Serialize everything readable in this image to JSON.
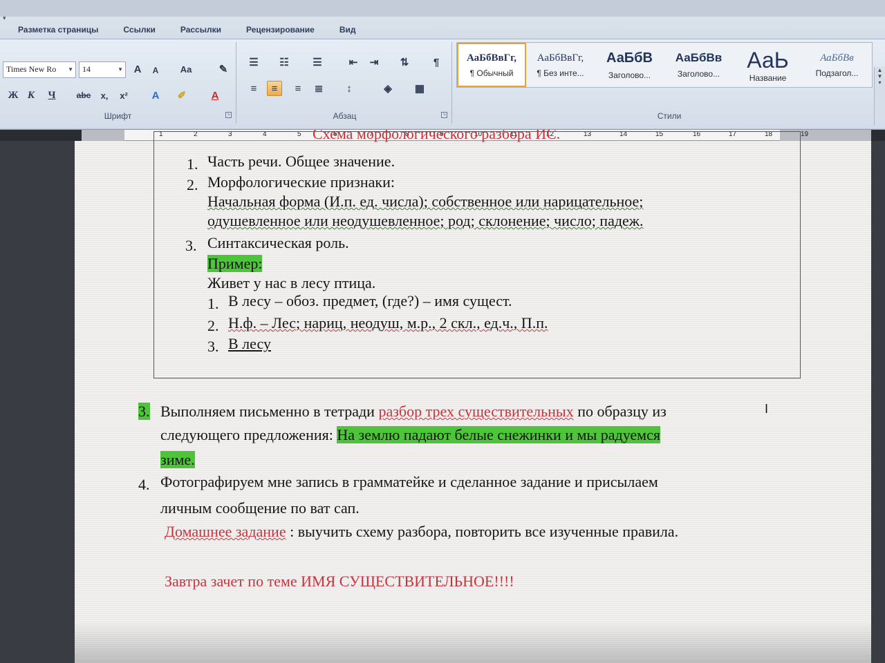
{
  "ribbon": {
    "tabs": [
      "Разметка страницы",
      "Ссылки",
      "Рассылки",
      "Рецензирование",
      "Вид"
    ],
    "font": {
      "name": "Times New Ro",
      "size": "14",
      "group_label": "Шрифт"
    },
    "paragraph": {
      "group_label": "Абзац"
    },
    "styles": {
      "group_label": "Стили",
      "items": [
        {
          "sample": "АаБбВвГг,",
          "name": "¶ Обычный"
        },
        {
          "sample": "АаБбВвГг,",
          "name": "¶ Без инте..."
        },
        {
          "sample": "АаБбВ",
          "name": "Заголово..."
        },
        {
          "sample": "АаБбВв",
          "name": "Заголово..."
        },
        {
          "sample": "АаЬ",
          "name": "Название"
        },
        {
          "sample": "АаБбВв",
          "name": "Подзагол..."
        }
      ]
    }
  },
  "ruler": {
    "numbers": [
      "1",
      "2",
      "3",
      "4",
      "5",
      "6",
      "7",
      "8",
      "9",
      "10",
      "11",
      "12",
      "13",
      "14",
      "15",
      "16",
      "17",
      "18",
      "19"
    ]
  },
  "document": {
    "cut_title": "Схема морфологического разбора ИС.",
    "list_items": [
      {
        "num": "1.",
        "text": "Часть речи. Общее значение."
      },
      {
        "num": "2.",
        "text": "Морфологические признаки:"
      },
      {
        "num": "3.",
        "text": "Синтаксическая роль."
      }
    ],
    "morph_line1": "Начальная форма (И.п. ед. числа); собственное или нарицательное;",
    "morph_line2": "одушевленное или неодушевленное; род; склонение; число; падеж.",
    "example_label": "Пример:",
    "example_sentence": "Живет у нас в лесу птица.",
    "sub_items": [
      {
        "num": "1.",
        "text": "В лесу – обоз. предмет, (где?) – имя сущест."
      },
      {
        "num": "2.",
        "text": "Н.ф. – Лес; нариц, неодуш, м.р., 2 скл., ед.ч., П.п."
      },
      {
        "num": "3.",
        "text": "В лесу"
      }
    ],
    "task3": {
      "num": "3.",
      "before": "Выполняем письменно в тетради",
      "red": "разбор трех существительных",
      "after": "по образцу из",
      "line2": "следующего предложения:",
      "highlight1": "На землю падают белые снежинки и мы радуемся",
      "highlight2": "зиме."
    },
    "task4": {
      "num": "4.",
      "line1": "Фотографируем мне запись в грамматейке  и сделанное задание  и присылаем",
      "line2": "личным сообщение по ват сап."
    },
    "homework_red": "Домашнее задание",
    "homework_rest": ": выучить схему разбора, повторить все изученные правила.",
    "tomorrow": "Завтра зачет по теме ИМЯ СУЩЕСТВИТЕЛЬНОЕ!!!!"
  }
}
